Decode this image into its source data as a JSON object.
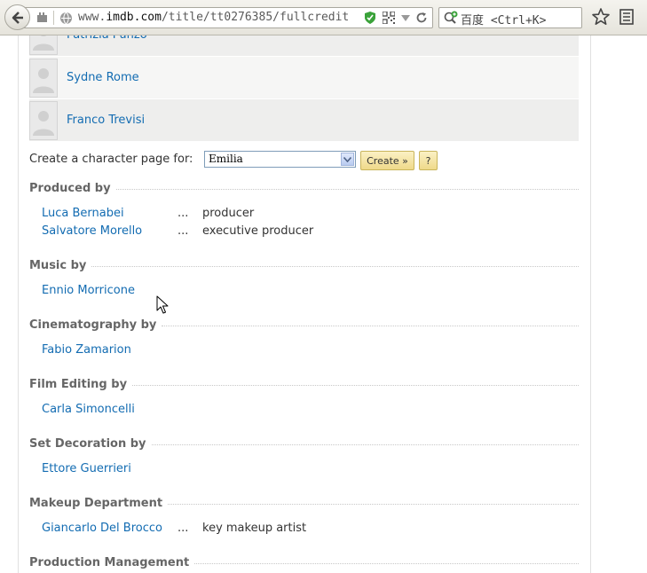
{
  "browser": {
    "url_prefix": "www.",
    "url_domain": "imdb.com",
    "url_path": "/title/tt0276385/fullcredit",
    "search_text": "百度 <Ctrl+K>"
  },
  "cast": [
    {
      "name": "Patrizia Punzo"
    },
    {
      "name": "Sydne Rome"
    },
    {
      "name": "Franco Trevisi"
    }
  ],
  "character_page": {
    "label": "Create a character page for:",
    "selected": "Emilia",
    "create_label": "Create »",
    "help_label": "?"
  },
  "sections": [
    {
      "title": "Produced by",
      "credits": [
        {
          "name": "Luca Bernabei",
          "dots": "...",
          "role": "producer"
        },
        {
          "name": "Salvatore Morello",
          "dots": "...",
          "role": "executive producer"
        }
      ]
    },
    {
      "title": "Music by",
      "credits": [
        {
          "name": "Ennio Morricone"
        }
      ]
    },
    {
      "title": "Cinematography by",
      "credits": [
        {
          "name": "Fabio Zamarion"
        }
      ]
    },
    {
      "title": "Film Editing by",
      "credits": [
        {
          "name": "Carla Simoncelli"
        }
      ]
    },
    {
      "title": "Set Decoration by",
      "credits": [
        {
          "name": "Ettore Guerrieri"
        }
      ]
    },
    {
      "title": "Makeup Department",
      "credits": [
        {
          "name": "Giancarlo Del Brocco",
          "dots": "...",
          "role": "key makeup artist"
        }
      ]
    },
    {
      "title": "Production Management",
      "credits": []
    }
  ]
}
